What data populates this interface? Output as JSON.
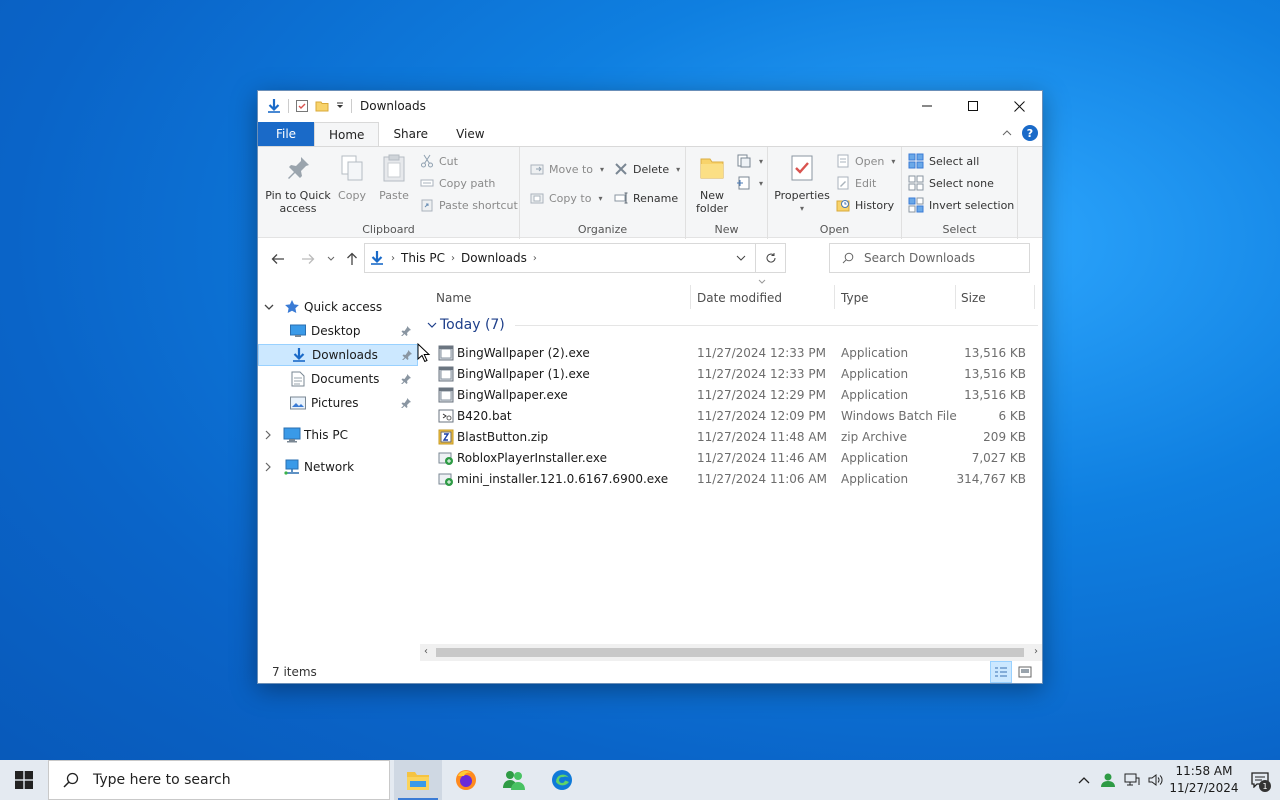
{
  "window": {
    "title": "Downloads",
    "tabs": {
      "file": "File",
      "home": "Home",
      "share": "Share",
      "view": "View"
    },
    "help": "?"
  },
  "ribbon": {
    "clipboard": {
      "label": "Clipboard",
      "pin_line1": "Pin to Quick",
      "pin_line2": "access",
      "copy": "Copy",
      "paste": "Paste",
      "cut": "Cut",
      "copy_path": "Copy path",
      "paste_shortcut": "Paste shortcut"
    },
    "organize": {
      "label": "Organize",
      "move_to": "Move to",
      "copy_to": "Copy to",
      "delete": "Delete",
      "rename": "Rename"
    },
    "new": {
      "label": "New",
      "new_line1": "New",
      "new_line2": "folder"
    },
    "open": {
      "label": "Open",
      "properties": "Properties",
      "open": "Open",
      "edit": "Edit",
      "history": "History"
    },
    "select": {
      "label": "Select",
      "select_all": "Select all",
      "select_none": "Select none",
      "invert": "Invert selection"
    }
  },
  "address": {
    "crumbs": [
      "This PC",
      "Downloads"
    ],
    "search_placeholder": "Search Downloads"
  },
  "nav": {
    "quick_access": "Quick access",
    "desktop": "Desktop",
    "downloads": "Downloads",
    "documents": "Documents",
    "pictures": "Pictures",
    "this_pc": "This PC",
    "network": "Network"
  },
  "columns": {
    "name": "Name",
    "date": "Date modified",
    "type": "Type",
    "size": "Size"
  },
  "group": {
    "title": "Today (7)"
  },
  "files": [
    {
      "name": "BingWallpaper (2).exe",
      "date": "11/27/2024 12:33 PM",
      "type": "Application",
      "size": "13,516 KB",
      "icon": "exe-icon"
    },
    {
      "name": "BingWallpaper (1).exe",
      "date": "11/27/2024 12:33 PM",
      "type": "Application",
      "size": "13,516 KB",
      "icon": "exe-icon"
    },
    {
      "name": "BingWallpaper.exe",
      "date": "11/27/2024 12:29 PM",
      "type": "Application",
      "size": "13,516 KB",
      "icon": "exe-icon"
    },
    {
      "name": "B420.bat",
      "date": "11/27/2024 12:09 PM",
      "type": "Windows Batch File",
      "size": "6 KB",
      "icon": "bat-icon"
    },
    {
      "name": "BlastButton.zip",
      "date": "11/27/2024 11:48 AM",
      "type": "zip Archive",
      "size": "209 KB",
      "icon": "zip-icon"
    },
    {
      "name": "RobloxPlayerInstaller.exe",
      "date": "11/27/2024 11:46 AM",
      "type": "Application",
      "size": "7,027 KB",
      "icon": "installer-icon"
    },
    {
      "name": "mini_installer.121.0.6167.6900.exe",
      "date": "11/27/2024 11:06 AM",
      "type": "Application",
      "size": "314,767 KB",
      "icon": "installer-icon"
    }
  ],
  "status": {
    "count": "7 items"
  },
  "taskbar": {
    "search_placeholder": "Type here to search",
    "time": "11:58 AM",
    "date": "11/27/2024",
    "notifications": "1"
  }
}
